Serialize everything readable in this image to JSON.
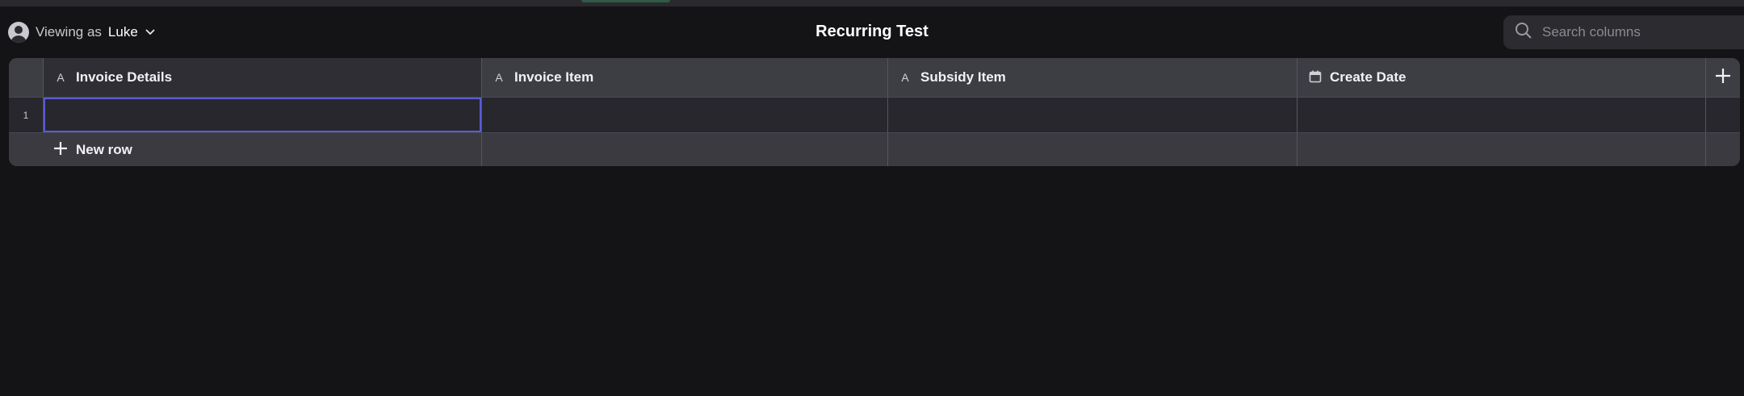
{
  "header": {
    "viewing_prefix": "Viewing as",
    "viewing_user": "Luke",
    "title": "Recurring Test",
    "search_placeholder": "Search columns"
  },
  "table": {
    "columns": [
      {
        "label": "Invoice Details",
        "type_icon": "text-type-icon"
      },
      {
        "label": "Invoice Item",
        "type_icon": "text-type-icon"
      },
      {
        "label": "Subsidy Item",
        "type_icon": "text-type-icon"
      },
      {
        "label": "Create Date",
        "type_icon": "calendar-icon"
      }
    ],
    "type_glyph_text": "A",
    "rows": [
      {
        "number": "1",
        "cells": [
          "",
          "",
          "",
          ""
        ]
      }
    ],
    "new_row_label": "New row"
  },
  "colors": {
    "background": "#141416",
    "selection": "#5b5bd6",
    "accent_strip": "#2f5a45"
  }
}
